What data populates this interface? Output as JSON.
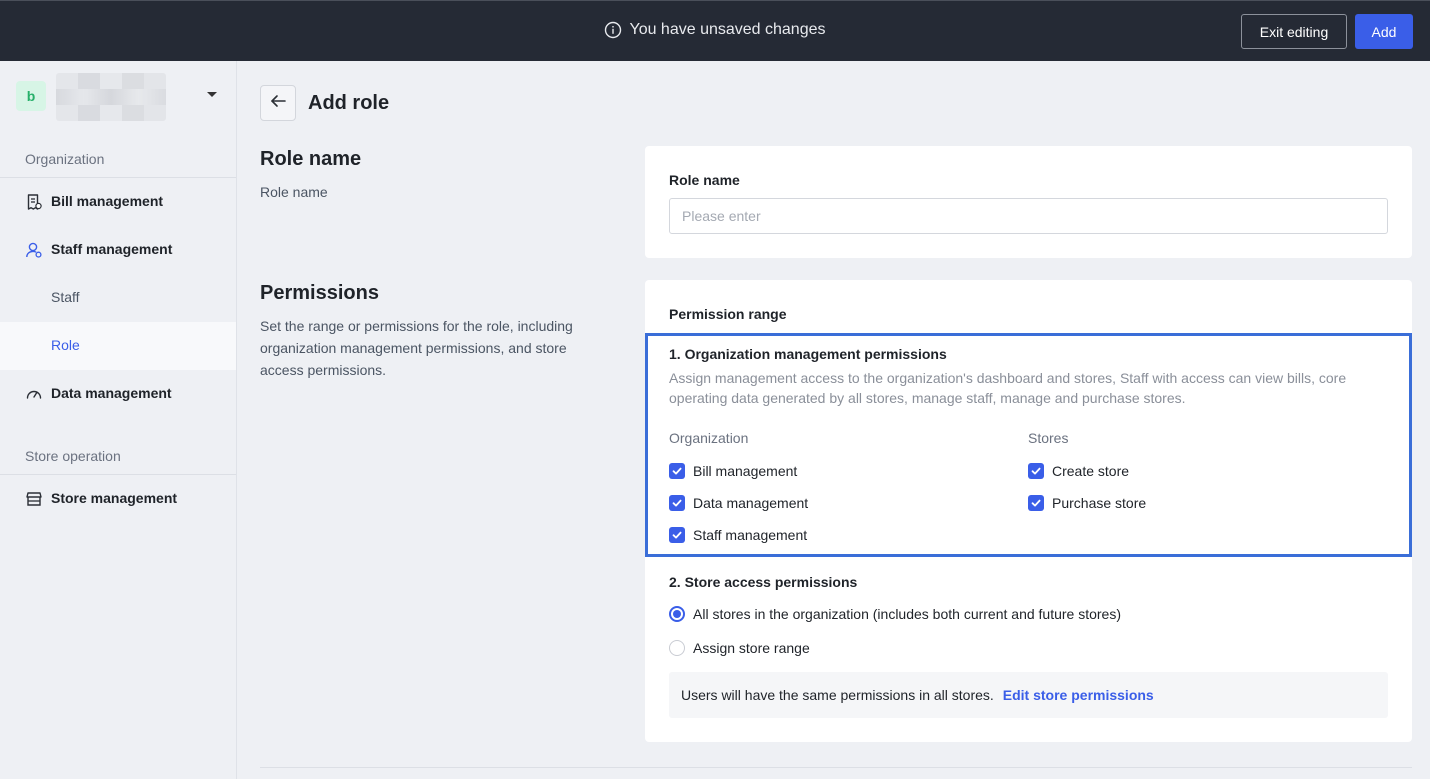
{
  "topbar": {
    "notice": "You have unsaved changes",
    "exit_label": "Exit editing",
    "add_label": "Add"
  },
  "sidebar": {
    "org_initial": "b",
    "sections": [
      {
        "title": "Organization"
      },
      {
        "title": "Store operation"
      }
    ],
    "items": [
      {
        "label": "Bill management",
        "icon": "bill-icon"
      },
      {
        "label": "Staff management",
        "icon": "staff-icon"
      },
      {
        "label": "Staff"
      },
      {
        "label": "Role"
      },
      {
        "label": "Data management",
        "icon": "gauge-icon"
      },
      {
        "label": "Store management",
        "icon": "store-icon"
      }
    ]
  },
  "page": {
    "title": "Add role"
  },
  "role_name_section": {
    "heading": "Role name",
    "desc": "Role name",
    "field_label": "Role name",
    "placeholder": "Please enter",
    "value": ""
  },
  "permissions_section": {
    "heading": "Permissions",
    "desc": "Set the range or permissions for the role, including organization management permissions, and store access permissions.",
    "range_label": "Permission range",
    "org": {
      "title": "1. Organization management permissions",
      "desc": "Assign management access to the organization's dashboard and stores, Staff with access can view bills, core operating data generated by all stores, manage staff, manage and purchase stores.",
      "col_org": "Organization",
      "col_stores": "Stores",
      "org_items": [
        {
          "label": "Bill management",
          "checked": true
        },
        {
          "label": "Data management",
          "checked": true
        },
        {
          "label": "Staff management",
          "checked": true
        }
      ],
      "store_items": [
        {
          "label": "Create store",
          "checked": true
        },
        {
          "label": "Purchase store",
          "checked": true
        }
      ]
    },
    "store": {
      "title": "2. Store access permissions",
      "options": [
        {
          "label": "All stores in the organization (includes both current and future stores)",
          "selected": true
        },
        {
          "label": "Assign store range",
          "selected": false
        }
      ],
      "info_text": "Users will have the same permissions in all stores.",
      "info_link": "Edit store permissions"
    }
  },
  "colors": {
    "accent": "#3a5ee8",
    "topbar": "#252a35",
    "highlight": "#3a6ed8"
  }
}
